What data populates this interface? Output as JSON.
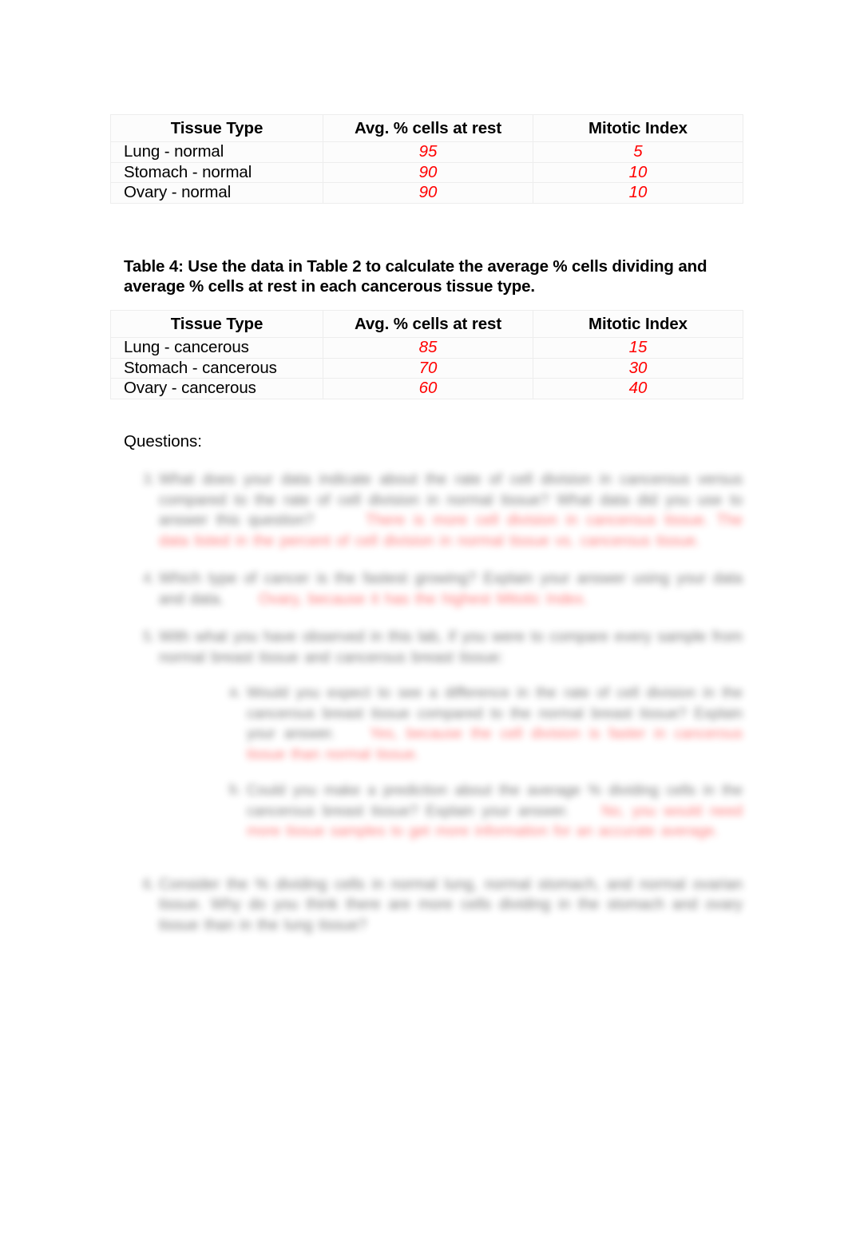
{
  "document": {
    "tables": [
      {
        "id": "table-3-normal",
        "columns": [
          "Tissue Type",
          "Avg. % cells at rest",
          "Mitotic Index"
        ],
        "rows": [
          {
            "tissue": "Lung - normal",
            "rest": "95",
            "mitotic": "5"
          },
          {
            "tissue": "Stomach - normal",
            "rest": "90",
            "mitotic": "10"
          },
          {
            "tissue": "Ovary - normal",
            "rest": "90",
            "mitotic": "10"
          }
        ]
      },
      {
        "id": "table-4-cancerous",
        "caption": "Table 4:  Use the data in Table 2 to calculate the average % cells dividing and average % cells at rest in each cancerous tissue type.",
        "columns": [
          "Tissue Type",
          "Avg. % cells at rest",
          "Mitotic Index"
        ],
        "rows": [
          {
            "tissue": "Lung - cancerous",
            "rest": "85",
            "mitotic": "15"
          },
          {
            "tissue": "Stomach - cancerous",
            "rest": "70",
            "mitotic": "30"
          },
          {
            "tissue": "Ovary - cancerous",
            "rest": "60",
            "mitotic": "40"
          }
        ]
      }
    ],
    "questions_heading": "Questions:",
    "questions": [
      {
        "marker": "3.",
        "text": "What does your data indicate about the rate of cell division in cancerous versus compared to the rate of cell division in normal tissue?    What data did you use to answer this question?",
        "answer": "There is more cell division in cancerous tissue.  The data listed in the percent of cell division in normal tissue vs. cancerous tissue.",
        "sub": []
      },
      {
        "marker": "4.",
        "text": "Which type of cancer is the fastest growing?           Explain your answer using your data and data.",
        "answer": "Ovary, because it has the highest Mitotic Index.",
        "sub": []
      },
      {
        "marker": "5.",
        "text": "With what you have observed in this lab, if you were to compare every sample from normal breast tissue and cancerous breast tissue:",
        "answer": "",
        "sub": [
          {
            "marker": "a.",
            "text": "Would you expect to see a difference in the rate of cell division in the cancerous breast tissue compared to the normal breast tissue?    Explain your answer.",
            "answer": "Yes, because the cell division is faster in cancerous tissue than normal tissue."
          },
          {
            "marker": "b.",
            "text": "Could you make a prediction about the average % dividing cells in the cancerous breast tissue?           Explain your answer.",
            "answer": "No, you would need more tissue samples to get more information for an accurate average."
          }
        ]
      },
      {
        "marker": "6.",
        "text": "Consider the % dividing cells in normal lung, normal stomach, and normal ovarian tissue.           Why do you think there are more cells dividing in the stomach and ovary tissue than in the lung tissue?",
        "answer": "",
        "sub": []
      }
    ],
    "colors": {
      "answer_red": "#ff0000",
      "text_black": "#000000",
      "table_border": "#ededed"
    }
  }
}
